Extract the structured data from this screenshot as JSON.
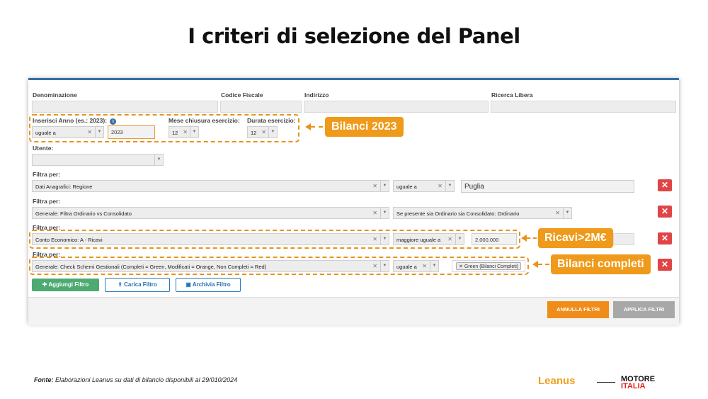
{
  "title": "I criteri di selezione del Panel",
  "top_fields": {
    "denominazione": "Denominazione",
    "codice_fiscale": "Codice Fiscale",
    "indirizzo": "Indirizzo",
    "ricerca_libera": "Ricerca Libera"
  },
  "year": {
    "label": "Inserisci Anno (es.: 2023):",
    "operator": "uguale a",
    "value": "2023",
    "month_label": "Mese chiusura esercizio:",
    "month_value": "12",
    "duration_label": "Durata esercizio:",
    "duration_value": "12"
  },
  "utente": {
    "label": "Utente:"
  },
  "filters": [
    {
      "label": "Filtra per:",
      "field": "Dati Anagrafici: Regione",
      "operator": "uguale a",
      "value": "Puglia"
    },
    {
      "label": "Filtra per:",
      "field": "Generale: Filtra Ordinario vs Consolidato",
      "operator": "Se presente sia Ordinario sia Consolidato: Ordinario"
    },
    {
      "label": "Filtra per:",
      "field": "Conto Economico: A - Ricavi",
      "operator": "maggiore uguale a",
      "value": "2.000.000"
    },
    {
      "label": "Filtra per:",
      "field": "Generale: Check Schemi Gestionali (Completi = Green, Modificati = Orange, Non Completi = Red)",
      "operator": "uguale a",
      "tag": "Green (Bilanci Completi)"
    }
  ],
  "callouts": {
    "year": "Bilanci 2023",
    "revenue": "Ricavi>2M€",
    "complete": "Bilanci completi"
  },
  "buttons": {
    "add": "Aggiungi Filtro",
    "load": "Carica Filtro",
    "archive": "Archivia Filtro",
    "cancel": "ANNULLA FILTRI",
    "apply": "APPLICA FILTRI"
  },
  "footer": {
    "source_label": "Fonte:",
    "source_text": "Elaborazioni Leanus su dati di bilancio disponibili al 29/010/2024",
    "logo_leanus": "Leanus",
    "logo_motore": "MOTORE",
    "logo_italia": "ITALIA"
  },
  "colors": {
    "accent": "#ef9a1a",
    "delete": "#e04545",
    "add_button": "#4daa72",
    "outline_button": "#2a7ac0",
    "panel_border": "#3a6ea5"
  },
  "icons": {
    "info": "info-icon",
    "clear": "clear-x-icon",
    "dropdown": "chevron-down-icon",
    "delete": "close-icon",
    "add": "plus-icon",
    "upload": "upload-icon",
    "save": "floppy-icon"
  }
}
